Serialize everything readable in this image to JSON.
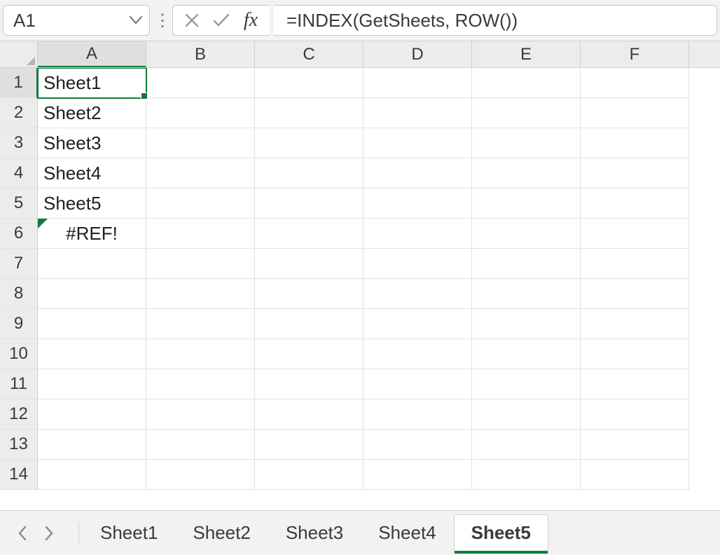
{
  "name_box": {
    "value": "A1"
  },
  "formula_bar": {
    "fx_label": "fx",
    "content": "=INDEX(GetSheets, ROW())"
  },
  "columns": [
    "A",
    "B",
    "C",
    "D",
    "E",
    "F"
  ],
  "rows": [
    {
      "num": "1",
      "cells": [
        "Sheet1",
        "",
        "",
        "",
        "",
        ""
      ]
    },
    {
      "num": "2",
      "cells": [
        "Sheet2",
        "",
        "",
        "",
        "",
        ""
      ]
    },
    {
      "num": "3",
      "cells": [
        "Sheet3",
        "",
        "",
        "",
        "",
        ""
      ]
    },
    {
      "num": "4",
      "cells": [
        "Sheet4",
        "",
        "",
        "",
        "",
        ""
      ]
    },
    {
      "num": "5",
      "cells": [
        "Sheet5",
        "",
        "",
        "",
        "",
        ""
      ]
    },
    {
      "num": "6",
      "cells": [
        "#REF!",
        "",
        "",
        "",
        "",
        ""
      ]
    },
    {
      "num": "7",
      "cells": [
        "",
        "",
        "",
        "",
        "",
        ""
      ]
    },
    {
      "num": "8",
      "cells": [
        "",
        "",
        "",
        "",
        "",
        ""
      ]
    },
    {
      "num": "9",
      "cells": [
        "",
        "",
        "",
        "",
        "",
        ""
      ]
    },
    {
      "num": "10",
      "cells": [
        "",
        "",
        "",
        "",
        "",
        ""
      ]
    },
    {
      "num": "11",
      "cells": [
        "",
        "",
        "",
        "",
        "",
        ""
      ]
    },
    {
      "num": "12",
      "cells": [
        "",
        "",
        "",
        "",
        "",
        ""
      ]
    },
    {
      "num": "13",
      "cells": [
        "",
        "",
        "",
        "",
        "",
        ""
      ]
    },
    {
      "num": "14",
      "cells": [
        "",
        "",
        "",
        "",
        "",
        ""
      ]
    }
  ],
  "selected": {
    "row": 0,
    "col": 0
  },
  "error_cells": [
    {
      "row": 5,
      "col": 0
    }
  ],
  "active_column_index": 0,
  "active_row_index": 0,
  "sheet_tabs": [
    "Sheet1",
    "Sheet2",
    "Sheet3",
    "Sheet4",
    "Sheet5"
  ],
  "active_sheet": "Sheet5"
}
